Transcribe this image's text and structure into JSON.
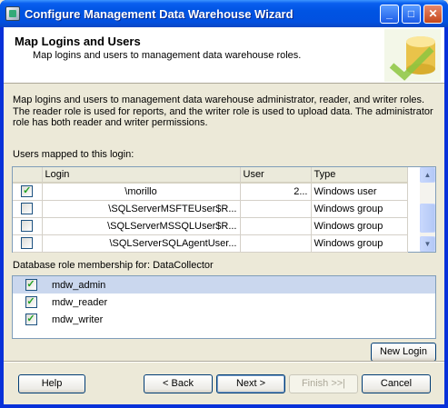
{
  "window": {
    "title": "Configure Management Data Warehouse Wizard"
  },
  "banner": {
    "title": "Map Logins and Users",
    "subtitle": "Map logins and users to management data warehouse roles."
  },
  "description": "Map logins and users to management data warehouse administrator, reader, and writer roles. The reader role is used for reports, and the writer role is used to upload data. The administrator role has both reader and writer permissions.",
  "users_label": "Users mapped to this login:",
  "users_grid": {
    "columns": [
      "",
      "Login",
      "User",
      "Type"
    ],
    "rows": [
      {
        "checked": true,
        "login": "\\morillo",
        "user": "2...",
        "type": "Windows user"
      },
      {
        "checked": false,
        "login": "\\SQLServerMSFTEUser$R...",
        "user": "",
        "type": "Windows group"
      },
      {
        "checked": false,
        "login": "\\SQLServerMSSQLUser$R...",
        "user": "",
        "type": "Windows group"
      },
      {
        "checked": false,
        "login": "\\SQLServerSQLAgentUser...",
        "user": "",
        "type": "Windows group"
      }
    ]
  },
  "roles_label": "Database role membership for: DataCollector",
  "roles": [
    {
      "checked": true,
      "name": "mdw_admin",
      "selected": true
    },
    {
      "checked": true,
      "name": "mdw_reader",
      "selected": false
    },
    {
      "checked": true,
      "name": "mdw_writer",
      "selected": false
    }
  ],
  "buttons": {
    "new_login": "New Login",
    "help": "Help",
    "back": "< Back",
    "next": "Next >",
    "finish": "Finish >>|",
    "cancel": "Cancel"
  },
  "colors": {
    "titlebar": "#0054e3",
    "selected_row": "#cad7ee",
    "check": "#21a121"
  }
}
